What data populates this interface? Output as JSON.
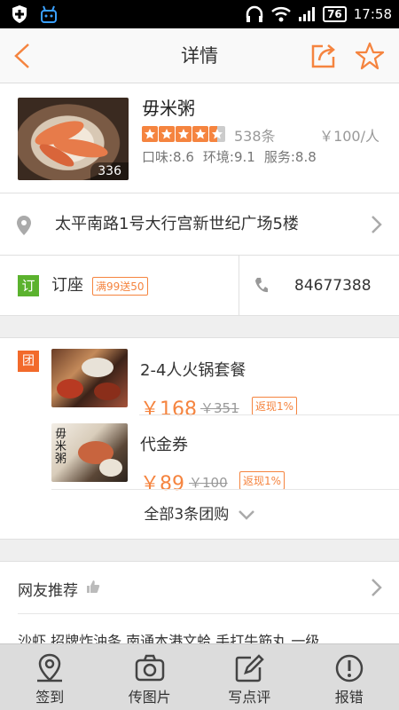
{
  "status_bar": {
    "battery": "76",
    "time": "17:58"
  },
  "header": {
    "title": "详情"
  },
  "shop": {
    "name": "毋米粥",
    "photo_count": "336",
    "rating": 4.5,
    "reviews": "538条",
    "price": "￥100/人",
    "scores": [
      "口味:8.6",
      "环境:9.1",
      "服务:8.8"
    ]
  },
  "address": "太平南路1号大行宫新世纪广场5楼",
  "booking": {
    "tag": "订",
    "label": "订座",
    "promo": "满99送50",
    "phone": "84677388"
  },
  "group_buy": {
    "tag": "团",
    "deals": [
      {
        "title": "2-4人火锅套餐",
        "price": "￥168",
        "old_price": "￥351",
        "cashback": "返现1%"
      },
      {
        "title": "代金券",
        "price": "￥89",
        "old_price": "￥100",
        "cashback": "返现1%"
      }
    ],
    "all_label": "全部3条团购"
  },
  "recommend": {
    "title": "网友推荐",
    "dishes": "沙虾  招牌炸油条  南通本港文蛤  手打牛筋丸  一级"
  },
  "tabs": [
    {
      "label": "签到",
      "icon": "location-pin-icon"
    },
    {
      "label": "传图片",
      "icon": "camera-icon"
    },
    {
      "label": "写点评",
      "icon": "edit-icon"
    },
    {
      "label": "报错",
      "icon": "error-icon"
    }
  ],
  "colors": {
    "accent": "#f5843f",
    "booking_green": "#5bb22e",
    "tuan_orange": "#f26a2b"
  }
}
